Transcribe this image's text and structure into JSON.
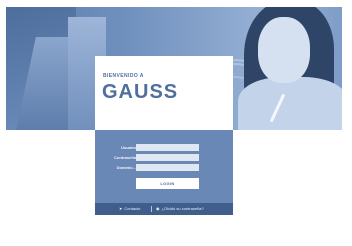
{
  "hero": {
    "welcome_text": "BIENVENIDO A",
    "brand_text": "GAUSS"
  },
  "form": {
    "user_label": "Usuario",
    "user_value": "",
    "password_label": "Contraseña",
    "password_value": "",
    "domain_label": "Dominio...",
    "domain_value": "",
    "login_label": "LOGIN"
  },
  "footer": {
    "contact_label": "Contacto",
    "contact_icon": "send-icon",
    "forgot_label": "¿Olvidó su contraseña?",
    "forgot_icon": "chat-bubble-icon"
  },
  "colors": {
    "banner": "#6f8fbd",
    "panel": "#6a88b5",
    "footer": "#3f5e8c",
    "brand_text": "#506f9d"
  }
}
